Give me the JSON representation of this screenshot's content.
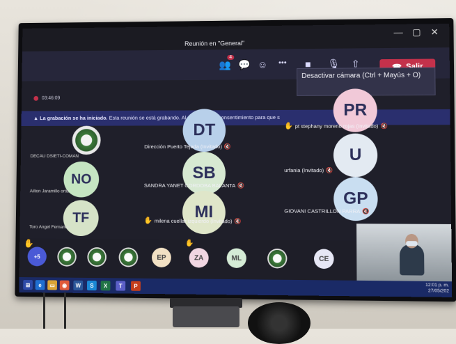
{
  "window": {
    "title": "Reunión en \"General\"",
    "badge_count": "4"
  },
  "toolbar": {
    "leave_label": "Salir",
    "more_label": "•••"
  },
  "tooltip": "Desactivar cámara (Ctrl + Mayús + O)",
  "timer": "03:46:09",
  "recording_banner": {
    "bold": "La grabación se ha iniciado.",
    "text": "Esta reunión se está grabando. Al unirse, da su consentimiento para que s"
  },
  "participants": [
    {
      "initials": "DT",
      "name": "Dirección Puerto Tejada (Invitado)"
    },
    {
      "initials": "SB",
      "name": "SANDRA YANET CORDOBA BALANTA"
    },
    {
      "initials": "MI",
      "name": "milena cuellar izquierdo (Invitado)"
    },
    {
      "initials": "PR",
      "name": "pt stephany moreno rojas (Invitado)"
    },
    {
      "initials": "U",
      "name": "urfania (Invitado)"
    },
    {
      "initials": "GP",
      "name": "GIOVANI CASTRILLON PARRA"
    },
    {
      "initials": "",
      "name": "DECAU DSIETI-COMAN"
    },
    {
      "initials": "NO",
      "name": "Ailton Jaramillo ortiz"
    },
    {
      "initials": "TF",
      "name": "Toro Angel Fernando"
    }
  ],
  "roster": {
    "overflow": "+5",
    "avatars": [
      "EP",
      "ZA",
      "ML",
      "CE"
    ]
  },
  "clock": {
    "time": "12:01 p. m.",
    "date": "27/05/202"
  },
  "colors": {
    "leave": "#c4314b",
    "banner": "#2a2f6e",
    "taskbar": "#1a2a66"
  }
}
